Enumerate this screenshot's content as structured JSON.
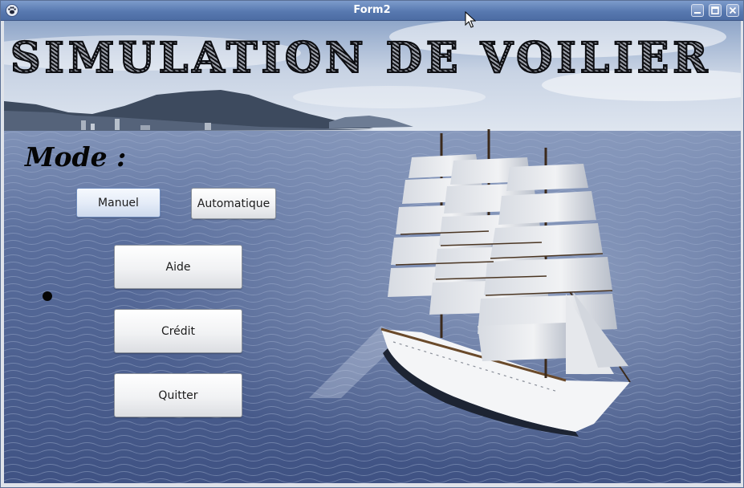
{
  "window": {
    "title": "Form2"
  },
  "heading": "SIMULATION DE VOILIER",
  "mode_label": "Mode :",
  "buttons": {
    "manuel": "Manuel",
    "automatique": "Automatique",
    "aide": "Aide",
    "credit": "Crédit",
    "quitter": "Quitter"
  },
  "icons": {
    "app": "paw-icon",
    "minimize": "minimize-icon",
    "maximize": "maximize-icon",
    "close": "close-icon"
  },
  "colors": {
    "titlebar": "#5879b0",
    "sea": "#4f6596",
    "sky": "#c8d3e4"
  }
}
